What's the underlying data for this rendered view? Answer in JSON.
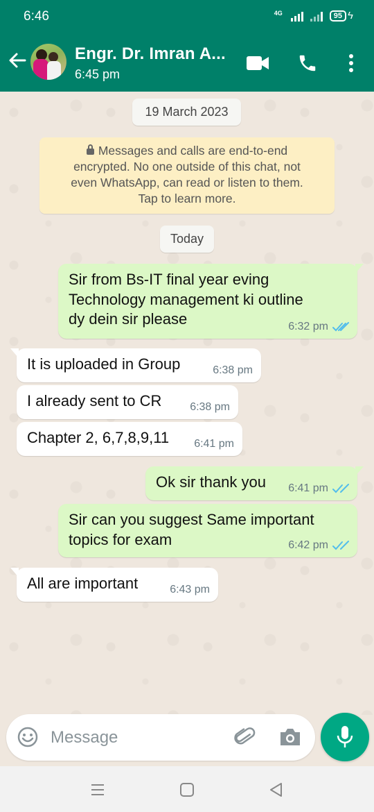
{
  "status_bar": {
    "time": "6:46",
    "network": "4G",
    "battery": "95"
  },
  "header": {
    "contact_name": "Engr. Dr. Imran A...",
    "last_seen": "6:45 pm",
    "icons": [
      "back-arrow-icon",
      "video-call-icon",
      "voice-call-icon",
      "more-vertical-icon"
    ]
  },
  "chat": {
    "date_chip_old": "19 March 2023",
    "encryption_notice": {
      "line1": "Messages and calls are end-to-end",
      "line2": "encrypted. No one outside of this chat, not",
      "line3": "even WhatsApp, can read or listen to them.",
      "line4": "Tap to learn more."
    },
    "date_chip_today": "Today",
    "messages": [
      {
        "dir": "out",
        "lines": [
          "Sir from Bs-IT final year eving",
          "Technology management ki outline",
          "dy dein sir please"
        ],
        "time": "6:32 pm",
        "status": "read"
      },
      {
        "dir": "in",
        "lines": [
          "It is uploaded in Group"
        ],
        "time": "6:38 pm"
      },
      {
        "dir": "in",
        "lines": [
          "I already sent to CR"
        ],
        "time": "6:38 pm"
      },
      {
        "dir": "in",
        "lines": [
          "Chapter 2, 6,7,8,9,11"
        ],
        "time": "6:41 pm"
      },
      {
        "dir": "out",
        "lines": [
          "Ok sir thank you"
        ],
        "time": "6:41 pm",
        "status": "read"
      },
      {
        "dir": "out",
        "lines": [
          "Sir can you suggest Same important",
          "topics for exam"
        ],
        "time": "6:42 pm",
        "status": "read"
      },
      {
        "dir": "in",
        "lines": [
          "All are important"
        ],
        "time": "6:43 pm"
      }
    ]
  },
  "composer": {
    "placeholder": "Message",
    "icons": [
      "emoji-icon",
      "attach-icon",
      "camera-icon",
      "mic-icon"
    ]
  },
  "colors": {
    "header": "#008069",
    "outgoing_bubble": "#dcf8c6",
    "incoming_bubble": "#ffffff",
    "read_ticks": "#53bdeb",
    "fab": "#00a884"
  }
}
